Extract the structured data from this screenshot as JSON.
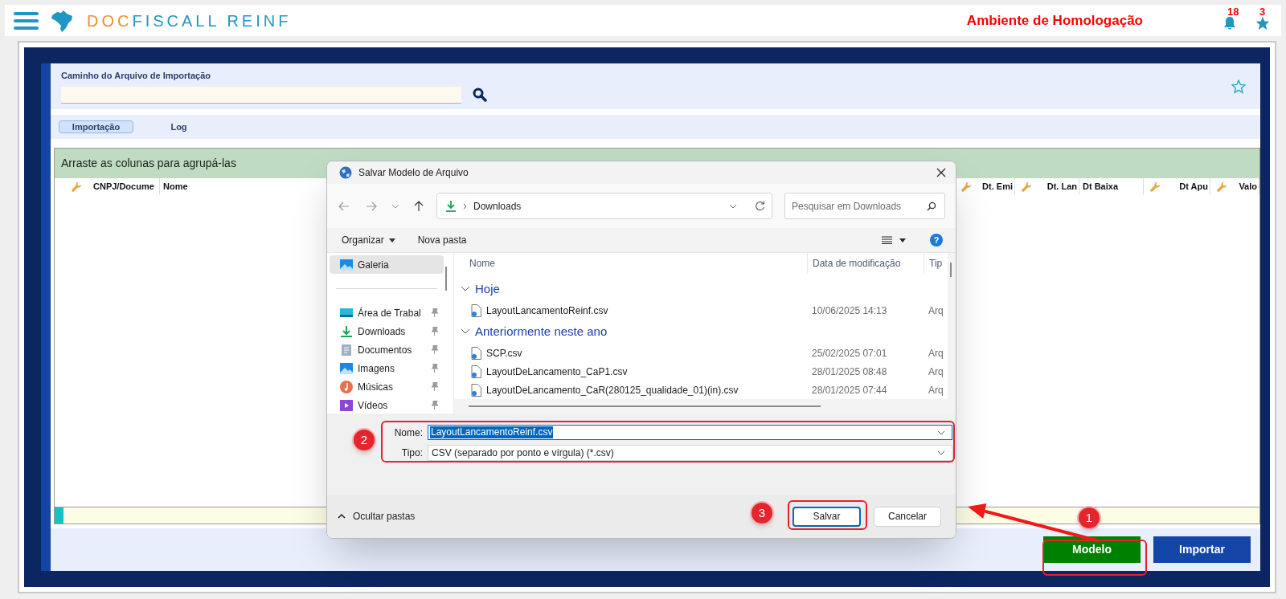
{
  "header": {
    "logo_parts": [
      {
        "text": "DOC",
        "color": "#f0902a"
      },
      {
        "text": "FISCALL REINF",
        "color": "#1f97c2"
      }
    ],
    "environment": "Ambiente de Homologação",
    "notification_count": "18",
    "favorites_count": "3"
  },
  "import": {
    "path_label": "Caminho do Arquivo de Importação",
    "tabs": [
      {
        "label": "Importação",
        "selected": true
      },
      {
        "label": "Log",
        "selected": false
      }
    ]
  },
  "grid": {
    "group_hint": "Arraste as colunas para agrupá-las",
    "columns": [
      {
        "label": "CNPJ/Docume",
        "filter": true
      },
      {
        "label": "Nome",
        "filter": false
      },
      {
        "label": "Dt. Emi",
        "filter": true
      },
      {
        "label": "Dt. Lan",
        "filter": true
      },
      {
        "label": "Dt Baixa",
        "filter": false
      },
      {
        "label": "Dt Apu",
        "filter": true
      },
      {
        "label": "Valo",
        "filter": true
      }
    ]
  },
  "actions": [
    {
      "label": "Modelo",
      "color": "#008000"
    },
    {
      "label": "Importar",
      "color": "#1446a8"
    }
  ],
  "dialog": {
    "title": "Salvar Modelo de Arquivo",
    "location": "Downloads",
    "search_placeholder": "Pesquisar em Downloads",
    "organize": "Organizar",
    "new_folder": "Nova pasta",
    "help": "?",
    "nav_items": [
      {
        "label": "Galeria",
        "selected": true,
        "pinned": false
      },
      {
        "label": "Área de Trabal",
        "selected": false,
        "pinned": true
      },
      {
        "label": "Downloads",
        "selected": false,
        "pinned": true
      },
      {
        "label": "Documentos",
        "selected": false,
        "pinned": true
      },
      {
        "label": "Imagens",
        "selected": false,
        "pinned": true
      },
      {
        "label": "Músicas",
        "selected": false,
        "pinned": true
      },
      {
        "label": "Vídeos",
        "selected": false,
        "pinned": true
      }
    ],
    "list_columns": [
      "Nome",
      "Data de modificação",
      "Tip"
    ],
    "groups": [
      {
        "label": "Hoje",
        "expanded": true,
        "files": [
          {
            "name": "LayoutLancamentoReinf.csv",
            "modified": "10/06/2025 14:13",
            "type": "Arq"
          }
        ]
      },
      {
        "label": "Anteriormente neste ano",
        "expanded": true,
        "files": [
          {
            "name": "SCP.csv",
            "modified": "25/02/2025 07:01",
            "type": "Arq"
          },
          {
            "name": "LayoutDeLancamento_CaP1.csv",
            "modified": "28/01/2025 08:48",
            "type": "Arq"
          },
          {
            "name": "LayoutDeLancamento_CaR(280125_qualidade_01)(in).csv",
            "modified": "28/01/2025 07:44",
            "type": "Arq"
          }
        ]
      }
    ],
    "file_name_label": "Nome:",
    "file_name": "LayoutLancamentoReinf.csv",
    "file_name_selected": true,
    "file_type_label": "Tipo:",
    "file_type": "CSV (separado por ponto e vírgula) (*.csv)",
    "hide_folders": "Ocultar pastas",
    "save": "Salvar",
    "cancel": "Cancelar"
  },
  "annotations": [
    {
      "label": "1"
    },
    {
      "label": "2"
    },
    {
      "label": "3"
    }
  ]
}
